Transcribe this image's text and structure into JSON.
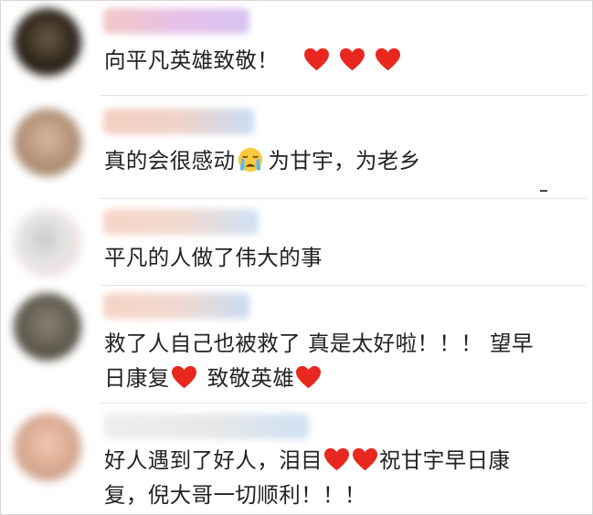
{
  "comments": [
    {
      "parts": [
        "向平凡英雄致敬！"
      ],
      "hearts": 3
    },
    {
      "before_emoji": "真的会很感动",
      "after_emoji": "为甘宇，为老乡"
    },
    {
      "text": "平凡的人做了伟大的事"
    },
    {
      "line1": "救了人自己也被救了 真是太好啦！！！ 望早",
      "line2_a": "日康复",
      "line2_b": "致敬英雄"
    },
    {
      "line1_a": "好人遇到了好人，泪目",
      "line1_b": "祝甘宇早日康",
      "line2": "复，倪大哥一切顺利！！！"
    }
  ],
  "colors": {
    "heart": "#e8281e",
    "text": "#222222"
  },
  "icons": {
    "heart": "heart-icon",
    "crying_face": "crying-face-emoji"
  }
}
